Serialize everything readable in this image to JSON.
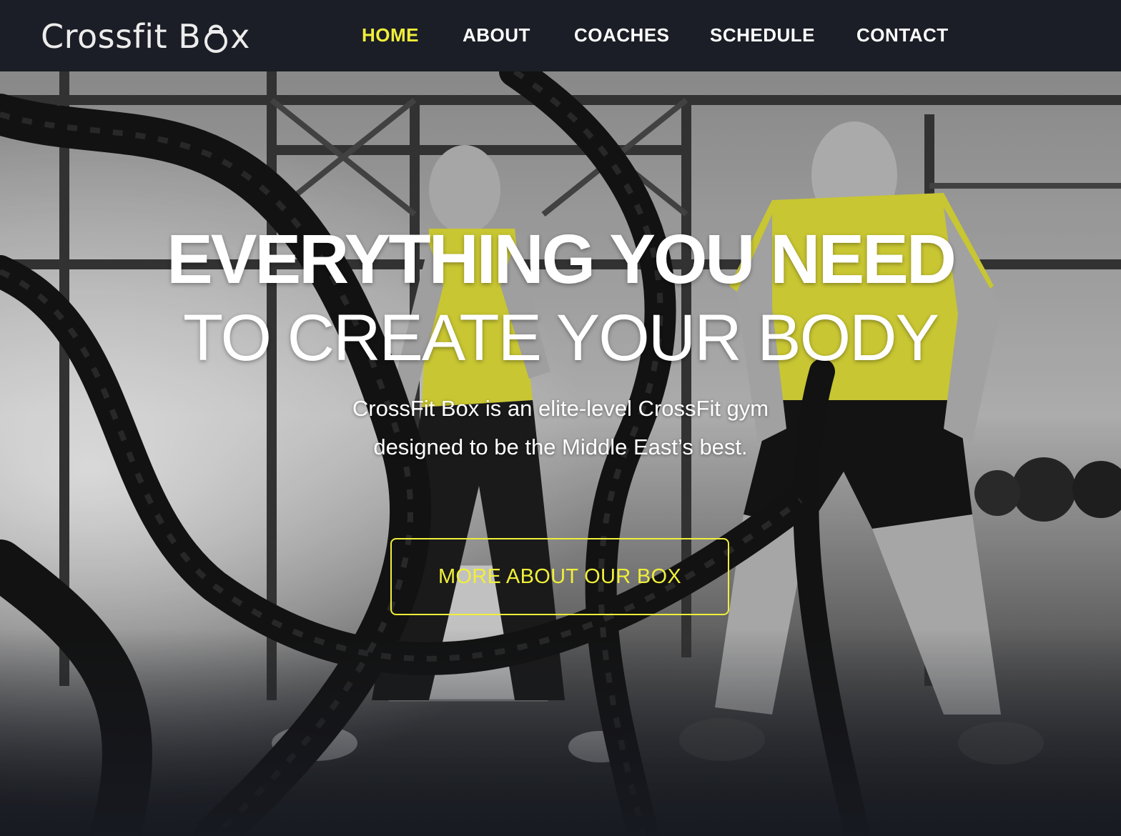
{
  "brand": {
    "logo_text_before": "Crossfit B",
    "logo_text_after": "x",
    "logo_icon": "kettlebell-icon",
    "accent_color": "#f0ef3a",
    "navbar_color": "#1b1e26"
  },
  "nav": {
    "items": [
      {
        "label": "HOME",
        "active": true
      },
      {
        "label": "ABOUT",
        "active": false
      },
      {
        "label": "COACHES",
        "active": false
      },
      {
        "label": "SCHEDULE",
        "active": false
      },
      {
        "label": "CONTACT",
        "active": false
      }
    ]
  },
  "hero": {
    "title": "EVERYTHING YOU NEED",
    "subtitle": "TO CREATE YOUR BODY",
    "description_line1": "CrossFit Box is an elite-level CrossFit gym",
    "description_line2": "designed to be the Middle East’s best.",
    "cta_label": "MORE ABOUT OUR BOX",
    "background": "black-and-white gym photo of two athletes using battle ropes, shirts tinted yellow"
  }
}
